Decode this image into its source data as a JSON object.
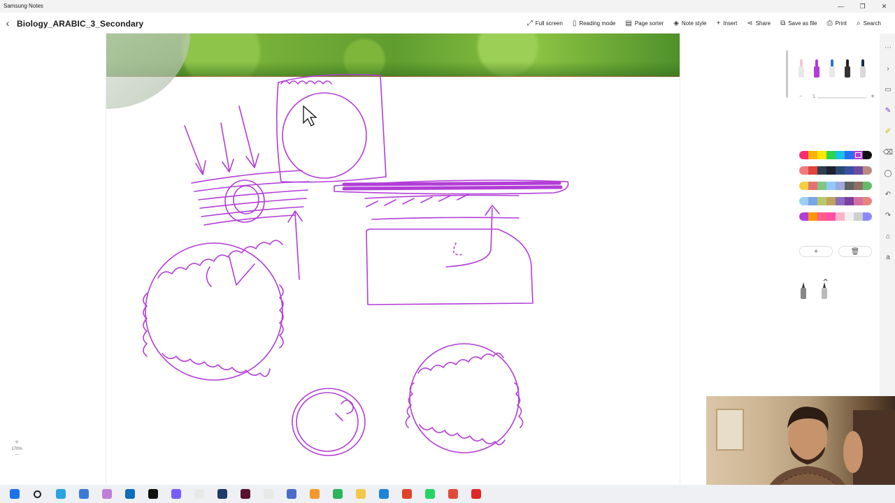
{
  "window": {
    "app_name": "Samsung Notes",
    "minimize": "—",
    "restore": "❐",
    "close": "✕"
  },
  "header": {
    "back_icon": "chevron-left-icon",
    "title": "Biology_ARABIC_3_Secondary",
    "tools": [
      {
        "label": "Full screen",
        "icon": "⤢"
      },
      {
        "label": "Reading mode",
        "icon": "▯"
      },
      {
        "label": "Page sorter",
        "icon": "▤"
      },
      {
        "label": "Note style",
        "icon": "◈"
      },
      {
        "label": "Insert",
        "icon": "+"
      },
      {
        "label": "Share",
        "icon": "⋖"
      },
      {
        "label": "Save as file",
        "icon": "⧉"
      },
      {
        "label": "Print",
        "icon": "⎙"
      },
      {
        "label": "Search",
        "icon": "⌕"
      }
    ]
  },
  "pen_panel": {
    "size_value": "1",
    "size_minus": "−",
    "size_plus": "+",
    "add_label": "+",
    "delete_label": "🗑",
    "pens": [
      {
        "tip": "#f4c6d0",
        "body": "#e8e8e8"
      },
      {
        "tip": "#b23ed6",
        "body": "#b23ed6"
      },
      {
        "tip": "#2f6fd1",
        "body": "#e8e8e8"
      },
      {
        "tip": "#222222",
        "body": "#333333"
      },
      {
        "tip": "#1c2a4a",
        "body": "#d8d8d8"
      }
    ],
    "palette_rows": [
      [
        "#ff2b6e",
        "#ffb300",
        "#ffe600",
        "#2bd64b",
        "#19c2e8",
        "#2a6ef0",
        "#b23ed6",
        "#111111"
      ],
      [
        "#f37b7b",
        "#e0443b",
        "#2f3d4f",
        "#1b2330",
        "#274b6e",
        "#3a4ea8",
        "#6c4ca3",
        "#b98b7c"
      ],
      [
        "#f4d03f",
        "#e57373",
        "#81c784",
        "#90caf9",
        "#9fa8da",
        "#616161",
        "#8d6e63",
        "#66bb6a"
      ],
      [
        "#9ad0f5",
        "#7aa5e8",
        "#b6c867",
        "#c1a35c",
        "#8e6bbf",
        "#7b3fa0",
        "#d66fa0",
        "#e5847a"
      ],
      [
        "#b23ed6",
        "#ff9800",
        "#ff5c8a",
        "#ff4fa3",
        "#f8b5c8",
        "#f1f1f1",
        "#cfcfcf",
        "#8a8aff"
      ]
    ]
  },
  "sidebar": {
    "icons": [
      "more-icon",
      "chevron-right-icon",
      "text-box-icon",
      "pen-icon",
      "highlighter-icon",
      "eraser-icon",
      "lasso-icon",
      "undo-icon",
      "redo-icon",
      "shape-icon",
      "text-format-icon"
    ]
  },
  "zoom": {
    "plus": "+",
    "level": "170%",
    "minus": "−"
  },
  "drawing": {
    "stroke_color": "#b23ed6"
  },
  "taskbar": {
    "apps": [
      {
        "name": "start-icon",
        "color": "#1a73e8"
      },
      {
        "name": "search-icon",
        "color": "#222222"
      },
      {
        "name": "telegram-icon",
        "color": "#2aa3df"
      },
      {
        "name": "app-icon",
        "color": "#3a7bd5"
      },
      {
        "name": "app-icon",
        "color": "#c07fd6"
      },
      {
        "name": "outlook-icon",
        "color": "#0f6cbd"
      },
      {
        "name": "app-icon",
        "color": "#111111"
      },
      {
        "name": "copilot-icon",
        "color": "#7b5cff"
      },
      {
        "name": "file-icon",
        "color": "#e8e8e8"
      },
      {
        "name": "audition-icon",
        "color": "#1d3b68"
      },
      {
        "name": "indesign-icon",
        "color": "#5a1030"
      },
      {
        "name": "file-icon",
        "color": "#e8e8e8"
      },
      {
        "name": "app-icon",
        "color": "#4a6cc8"
      },
      {
        "name": "app-icon",
        "color": "#f19a2b"
      },
      {
        "name": "camtasia-icon",
        "color": "#2fb35a"
      },
      {
        "name": "folder-icon",
        "color": "#f2c84b"
      },
      {
        "name": "edge-icon",
        "color": "#1b86d8"
      },
      {
        "name": "chrome-icon",
        "color": "#e0422c"
      },
      {
        "name": "whatsapp-icon",
        "color": "#25d366"
      },
      {
        "name": "app-icon",
        "color": "#e04a3a"
      },
      {
        "name": "recorder-icon",
        "color": "#e02828"
      }
    ]
  }
}
